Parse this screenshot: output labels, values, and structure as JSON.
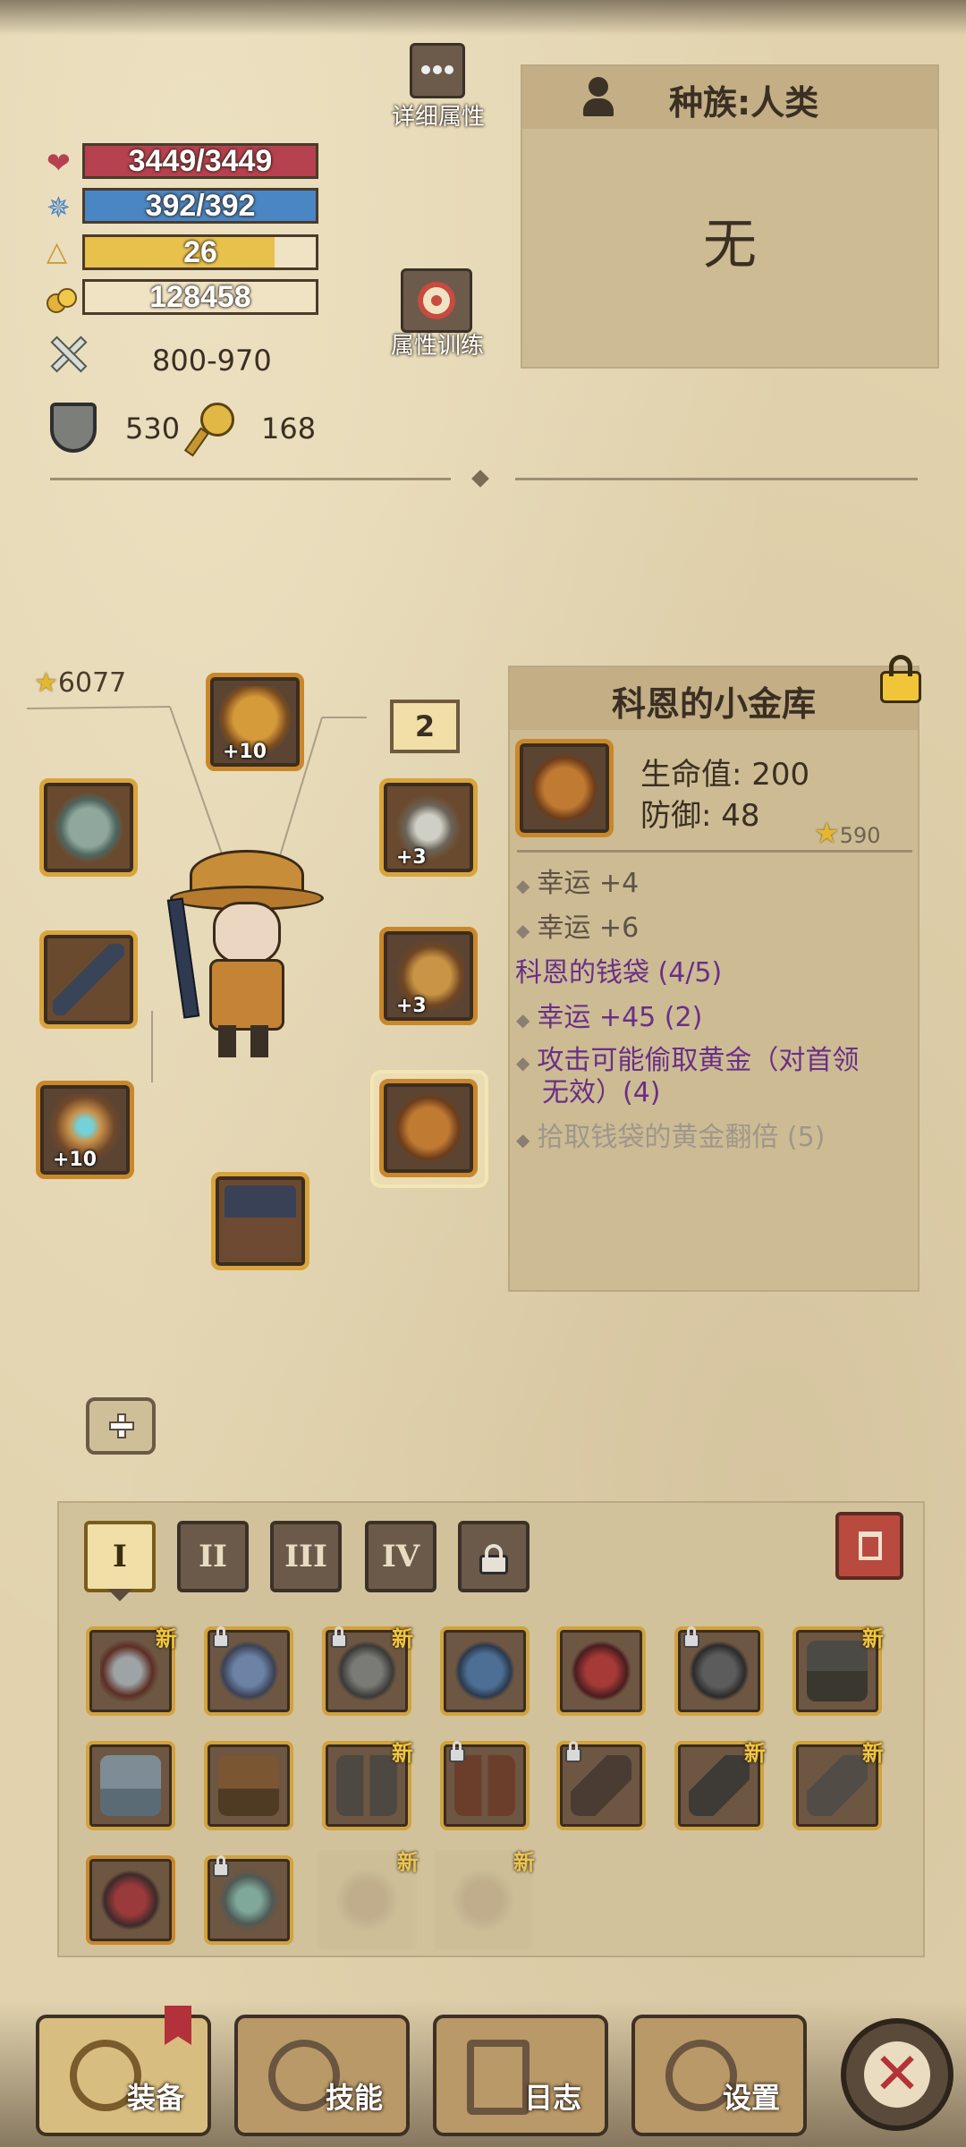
{
  "top_buttons": {
    "detail_attrs": "详细属性",
    "attr_training": "属性训练"
  },
  "stats": {
    "hp": "3449/3449",
    "mp": "392/392",
    "level": "26",
    "level_progress": 0.82,
    "gold": "128458",
    "attack": "800-970",
    "defense": "530",
    "magic": "168"
  },
  "race_panel": {
    "race": "种族:人类",
    "title": "无"
  },
  "equipment": {
    "score": "6077",
    "head_plus": "+10",
    "amulet_plus": "+3",
    "weapon2_plus": "+3",
    "ring_plus": "+10",
    "slot_counter": "2"
  },
  "item_detail": {
    "name": "科恩的小金库",
    "hp": "生命值: 200",
    "def": "防御: 48",
    "score": "590",
    "affixes": [
      "幸运 +4",
      "幸运 +6"
    ],
    "set_title": "科恩的钱袋 (4/5)",
    "set_bonuses": [
      "幸运 +45 (2)",
      "攻击可能偷取黄金（对首领",
      "无效）(4)",
      "拾取钱袋的黄金翻倍 (5)"
    ]
  },
  "inventory": {
    "pages": [
      "I",
      "II",
      "III",
      "IV"
    ],
    "new_badge": "新"
  },
  "nav": {
    "equip": "装备",
    "skills": "技能",
    "log": "日志",
    "settings": "设置"
  },
  "colors": {
    "hp": "#b5424e",
    "mp": "#4a86c4",
    "xp": "#e8c04c",
    "set": "#6a2f86"
  }
}
